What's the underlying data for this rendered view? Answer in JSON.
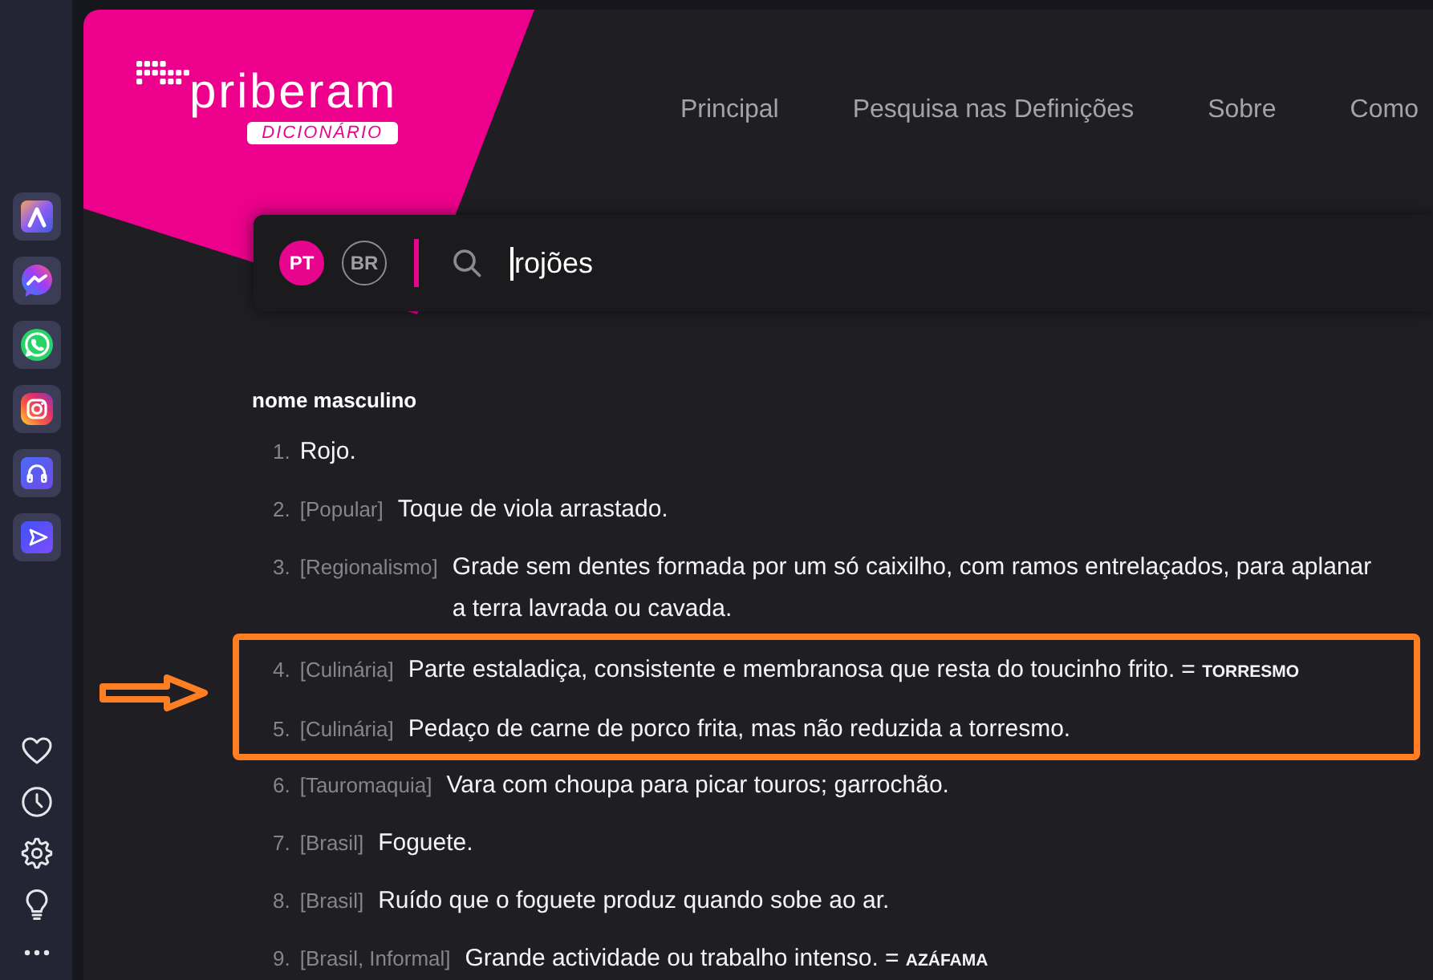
{
  "logo": {
    "wordmark": "priberam",
    "badge": "DICIONÁRIO"
  },
  "nav": [
    {
      "label": "Principal"
    },
    {
      "label": "Pesquisa nas Definições"
    },
    {
      "label": "Sobre"
    },
    {
      "label": "Como"
    }
  ],
  "search": {
    "languages": [
      {
        "label": "PT",
        "selected": true
      },
      {
        "label": "BR",
        "selected": false
      }
    ],
    "value": "rojões",
    "focused": true
  },
  "entry": {
    "grammar": "nome masculino",
    "definitions": [
      {
        "number": "1.",
        "text": "Rojo.",
        "highlighted": false
      },
      {
        "number": "2.",
        "tag": "[Popular]",
        "text": "Toque de viola arrastado.",
        "highlighted": false
      },
      {
        "number": "3.",
        "tag": "[Regionalismo]",
        "text": "Grade sem dentes formada por um só caixilho, com ramos entrelaçados, para aplanar a terra lavrada ou cavada.",
        "highlighted": false
      },
      {
        "number": "4.",
        "tag": "[Culinária]",
        "text": "Parte estaladiça, consistente e membranosa que resta do toucinho frito.",
        "synonym": {
          "sign": "=",
          "word": "TORRESMO"
        },
        "highlighted": true
      },
      {
        "number": "5.",
        "tag": "[Culinária]",
        "text": "Pedaço de carne de porco frita, mas não reduzida a torresmo.",
        "highlighted": true
      },
      {
        "number": "6.",
        "tag": "[Tauromaquia]",
        "text": "Vara com choupa para picar touros; garrochão.",
        "highlighted": false
      },
      {
        "number": "7.",
        "tag": "[Brasil]",
        "text": "Foguete.",
        "highlighted": false
      },
      {
        "number": "8.",
        "tag": "[Brasil]",
        "text": "Ruído que o foguete produz quando sobe ao ar.",
        "highlighted": false
      },
      {
        "number": "9.",
        "tag": "[Brasil, Informal]",
        "text": "Grande actividade ou trabalho intenso.",
        "synonym": {
          "sign": "=",
          "word": "AZÁFAMA"
        },
        "highlighted": false
      }
    ]
  }
}
